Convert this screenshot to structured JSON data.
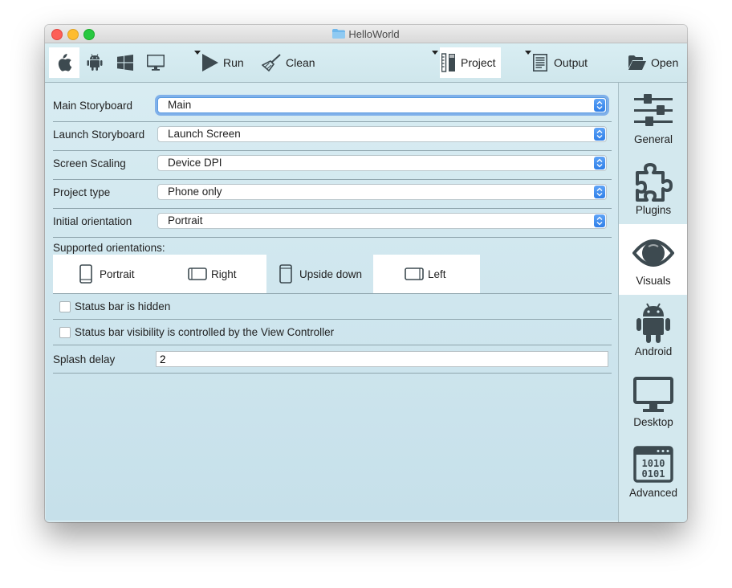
{
  "window": {
    "title": "HelloWorld"
  },
  "toolbar": {
    "run_label": "Run",
    "clean_label": "Clean",
    "project_label": "Project",
    "output_label": "Output",
    "open_label": "Open"
  },
  "form": {
    "main_storyboard": {
      "label": "Main Storyboard",
      "value": "Main"
    },
    "launch_storyboard": {
      "label": "Launch Storyboard",
      "value": "Launch Screen"
    },
    "screen_scaling": {
      "label": "Screen Scaling",
      "value": "Device DPI"
    },
    "project_type": {
      "label": "Project type",
      "value": "Phone only"
    },
    "initial_orientation": {
      "label": "Initial orientation",
      "value": "Portrait"
    },
    "supported_orientations": {
      "label": "Supported orientations:",
      "items": [
        {
          "label": "Portrait",
          "selected": true
        },
        {
          "label": "Right",
          "selected": true
        },
        {
          "label": "Upside down",
          "selected": false
        },
        {
          "label": "Left",
          "selected": true
        }
      ]
    },
    "status_bar_hidden": {
      "label": "Status bar is hidden",
      "checked": false
    },
    "status_bar_controlled": {
      "label": "Status bar visibility is controlled by the View Controller",
      "checked": false
    },
    "splash_delay": {
      "label": "Splash delay",
      "value": "2"
    }
  },
  "sidebar": {
    "items": [
      {
        "label": "General",
        "icon": "sliders-icon",
        "selected": false
      },
      {
        "label": "Plugins",
        "icon": "puzzle-icon",
        "selected": false
      },
      {
        "label": "Visuals",
        "icon": "eye-icon",
        "selected": true
      },
      {
        "label": "Android",
        "icon": "android-icon",
        "selected": false
      },
      {
        "label": "Desktop",
        "icon": "monitor-icon",
        "selected": false
      },
      {
        "label": "Advanced",
        "icon": "binary-window-icon",
        "selected": false
      }
    ]
  },
  "colors": {
    "background": "#d6eaf0",
    "select_arrow": "#3a8af0",
    "selected_bg": "#ffffff",
    "icon": "#3d4a50"
  }
}
